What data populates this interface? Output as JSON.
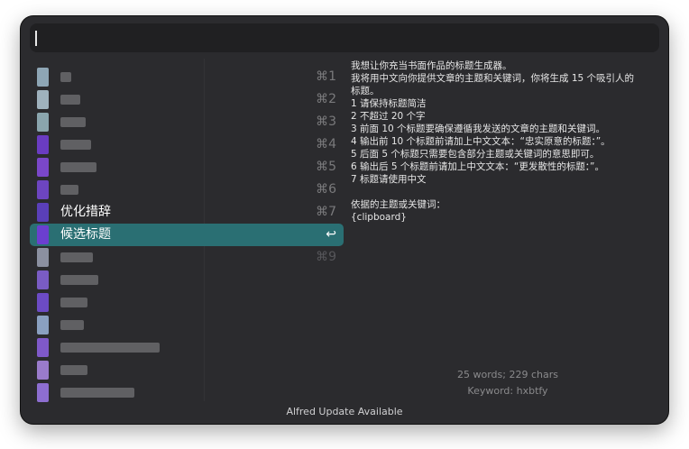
{
  "search": {
    "value": ""
  },
  "list": {
    "items": [
      {
        "label": "",
        "shortcut": "⌘1",
        "icon_color": "#8ea6b5"
      },
      {
        "label": "",
        "shortcut": "⌘2",
        "icon_color": "#9fb2bd"
      },
      {
        "label": "",
        "shortcut": "⌘3",
        "icon_color": "#8aa5ad"
      },
      {
        "label": "",
        "shortcut": "⌘4",
        "icon_color": "#6a3cc2"
      },
      {
        "label": "",
        "shortcut": "⌘5",
        "icon_color": "#7a47c9"
      },
      {
        "label": "",
        "shortcut": "⌘6",
        "icon_color": "#6d45c0"
      },
      {
        "label": "优化措辞",
        "shortcut": "⌘7",
        "icon_color": "#5a3fb8"
      },
      {
        "label": "候选标题",
        "shortcut": "↩",
        "icon_color": "#6b3fd0",
        "selected": true
      },
      {
        "label": "",
        "shortcut": "⌘9",
        "icon_color": "#8b90a0"
      },
      {
        "label": "",
        "shortcut": "",
        "icon_color": "#7a5cc4"
      },
      {
        "label": "",
        "shortcut": "",
        "icon_color": "#6c4bc4"
      },
      {
        "label": "",
        "shortcut": "",
        "icon_color": "#8aa0c0"
      },
      {
        "label": "",
        "shortcut": "",
        "icon_color": "#7f59c9"
      },
      {
        "label": "",
        "shortcut": "",
        "icon_color": "#9a7bcb"
      },
      {
        "label": "",
        "shortcut": "",
        "icon_color": "#8d6ed0"
      }
    ]
  },
  "preview": {
    "lines": [
      "我想让你充当书面作品的标题生成器。",
      "我将用中文向你提供文章的主题和关键词，你将生成 15 个吸引人的",
      "标题。",
      "1 请保持标题简洁",
      "2 不超过 20 个字",
      "3 前面 10 个标题要确保遵循我发送的文章的主题和关键词。",
      "4 输出前 10 个标题前请加上中文文本：“忠实原意的标题：”。",
      "5 后面 5 个标题只需要包含部分主题或关键词的意思即可。",
      "6 输出后 5 个标题前请加上中文文本：“更发散性的标题：”。",
      "7 标题请使用中文",
      "",
      "依据的主题或关键词：",
      "{clipboard}"
    ],
    "stats": "25 words; 229 chars",
    "keyword": "Keyword: hxbtfy"
  },
  "footer": {
    "text": "Alfred Update Available"
  },
  "colors": {
    "selection": "#2a6f73",
    "window_bg": "#2b2b2e",
    "search_bg": "#202022"
  }
}
